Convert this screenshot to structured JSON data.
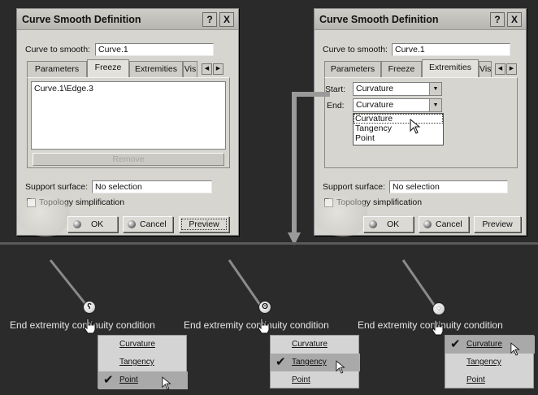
{
  "dialog_left": {
    "title": "Curve Smooth Definition",
    "help_label": "?",
    "close_label": "X",
    "curve_label": "Curve to smooth:",
    "curve_value": "Curve.1",
    "tabs": [
      "Parameters",
      "Freeze",
      "Extremities",
      "Vis"
    ],
    "active_tab": "Freeze",
    "list_item": "Curve.1\\Edge.3",
    "remove_label": "Remove",
    "support_label": "Support surface:",
    "support_value": "No selection",
    "topology_label": "Topology simplification",
    "ok_label": "OK",
    "cancel_label": "Cancel",
    "preview_label": "Preview"
  },
  "dialog_right": {
    "title": "Curve Smooth Definition",
    "help_label": "?",
    "close_label": "X",
    "curve_label": "Curve to smooth:",
    "curve_value": "Curve.1",
    "tabs": [
      "Parameters",
      "Freeze",
      "Extremities",
      "Vis"
    ],
    "active_tab": "Extremities",
    "start_label": "Start:",
    "start_value": "Curvature",
    "end_label": "End:",
    "end_value": "Curvature",
    "end_options": [
      "Curvature",
      "Tangency",
      "Point"
    ],
    "support_label": "Support surface:",
    "support_value": "No selection",
    "topology_label": "Topology simplification",
    "ok_label": "OK",
    "cancel_label": "Cancel",
    "preview_label": "Preview"
  },
  "context_panels": [
    {
      "label": "End extremity continuity condition",
      "items": [
        "Curvature",
        "Tangency",
        "Point"
      ],
      "checked": "Point"
    },
    {
      "label": "End extremity continuity condition",
      "items": [
        "Curvature",
        "Tangency",
        "Point"
      ],
      "checked": "Tangency"
    },
    {
      "label": "End extremity continuity condition",
      "items": [
        "Curvature",
        "Tangency",
        "Point"
      ],
      "checked": "Curvature"
    }
  ],
  "colors": {
    "background": "#2a2a2a",
    "dialog": "#d7d5d0",
    "arrow": "#9a9a9a",
    "menu_highlight": "#a9a9a9"
  }
}
